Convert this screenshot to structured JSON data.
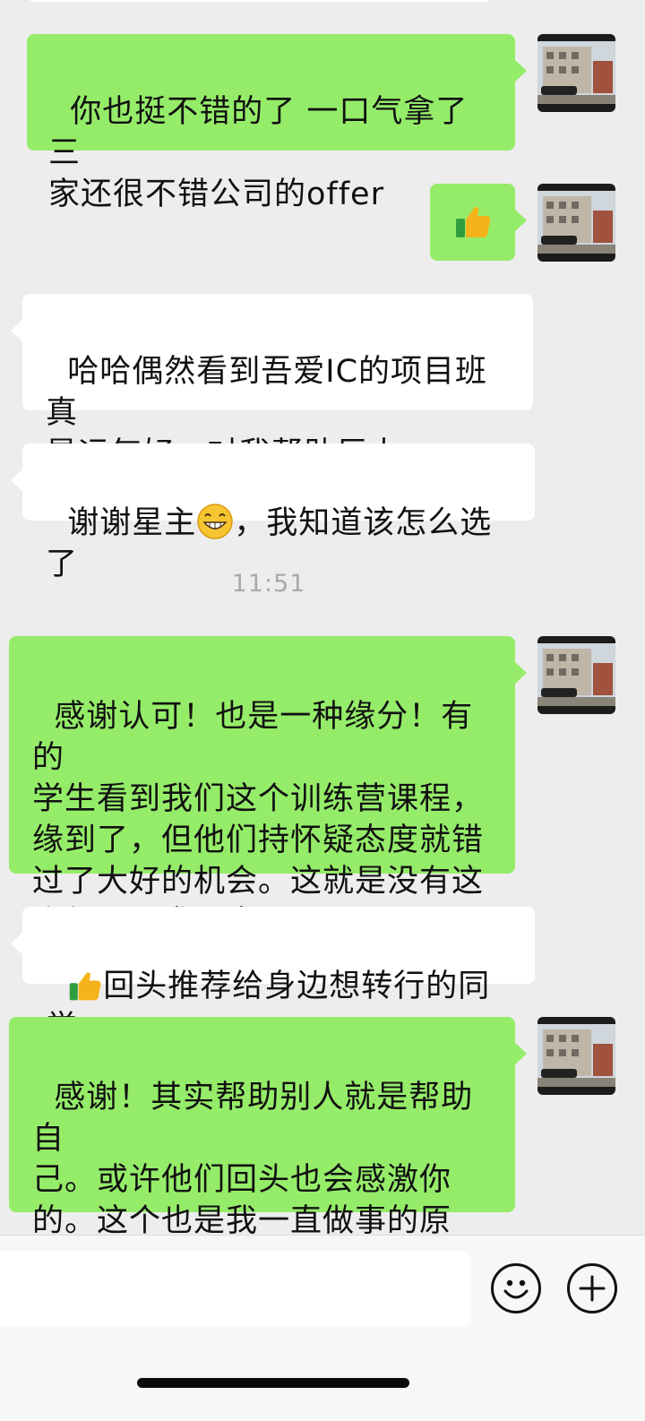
{
  "chat": {
    "messages": [
      {
        "side": "right",
        "text": "你也挺不错的了 一口气拿了三\n家还很不错公司的offer"
      },
      {
        "side": "right",
        "emoji": "thumbs-up"
      },
      {
        "side": "left",
        "text": "哈哈偶然看到吾爱IC的项目班真\n是运气好，对我帮助巨大"
      },
      {
        "side": "left",
        "text_before": "谢谢星主",
        "emoji": "grin",
        "text_after": "，我知道该怎么选了"
      },
      {
        "side": "right",
        "text": "感谢认可！也是一种缘分！有的\n学生看到我们这个训练营课程，\n缘到了，但他们持怀疑态度就错\n过了大好的机会。这就是没有这\n个份，强求不来。"
      },
      {
        "side": "left",
        "emoji": "thumbs-up",
        "text_after": "回头推荐给身边想转行的同学"
      },
      {
        "side": "right",
        "text": "感谢！其实帮助别人就是帮助自\n己。或许他们回头也会感激你\n的。这个也是我一直做事的原\n则。"
      }
    ],
    "timestamp": "11:51"
  },
  "input_bar": {
    "value": "",
    "emoji_button_icon": "smiley-face-icon",
    "plus_button_icon": "plus-icon"
  },
  "colors": {
    "background": "#ededed",
    "sent_bubble": "#95ec69",
    "received_bubble": "#ffffff",
    "timestamp_text": "#a9a9a9"
  }
}
